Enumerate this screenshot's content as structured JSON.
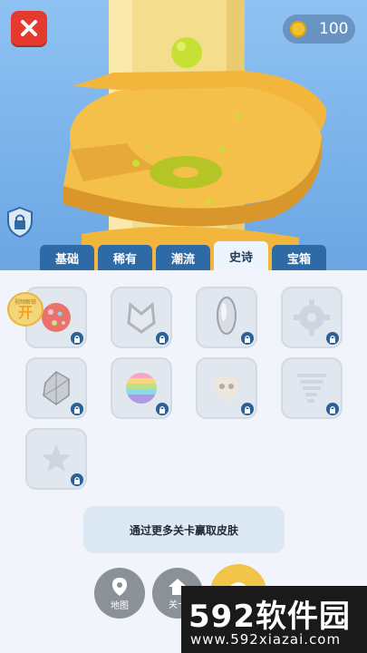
{
  "header": {
    "close_icon": "close-x-icon",
    "coins": "100"
  },
  "tabs": [
    {
      "label": "基础",
      "active": false
    },
    {
      "label": "稀有",
      "active": false
    },
    {
      "label": "潮流",
      "active": false
    },
    {
      "label": "史诗",
      "active": true
    },
    {
      "label": "宝箱",
      "active": false
    }
  ],
  "skins": {
    "badge_text": "开",
    "badge_caption": "视频解锁"
  },
  "banner": {
    "text": "通过更多关卡赢取皮肤"
  },
  "nav": {
    "map_label": "地图",
    "level_label": "关卡"
  },
  "watermark": {
    "title": "592软件园",
    "url": "www.592xiazai.com"
  },
  "colors": {
    "accent": "#2e6aa6",
    "close": "#e63a2e",
    "tower": "#f4dd8c",
    "platform": "#f2b63d",
    "ball": "#c7e034"
  }
}
